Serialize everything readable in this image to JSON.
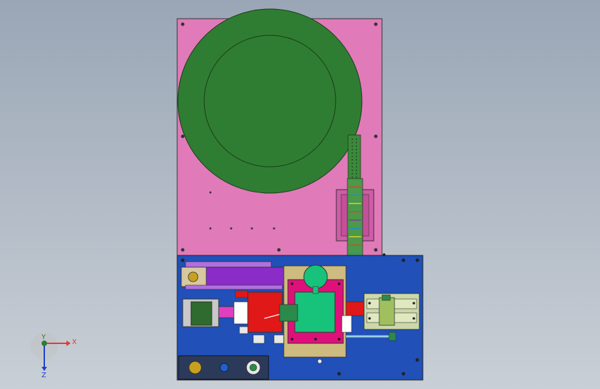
{
  "axis": {
    "x_label": "X",
    "y_label": "Y",
    "z_label": "Z",
    "x_color": "#e53935",
    "y_color": "#2e7d32",
    "z_color": "#1e40c8"
  },
  "colors": {
    "top_plate": "#e07ab8",
    "base_plate": "#2050b8",
    "disc": "#2f7d32",
    "purple_block": "#8a2cc8",
    "red_block": "#e01818",
    "tan_frame": "#cdbb80",
    "magenta_frame": "#e0107a",
    "green_body": "#17c27a",
    "track": "#3a8a3a"
  }
}
